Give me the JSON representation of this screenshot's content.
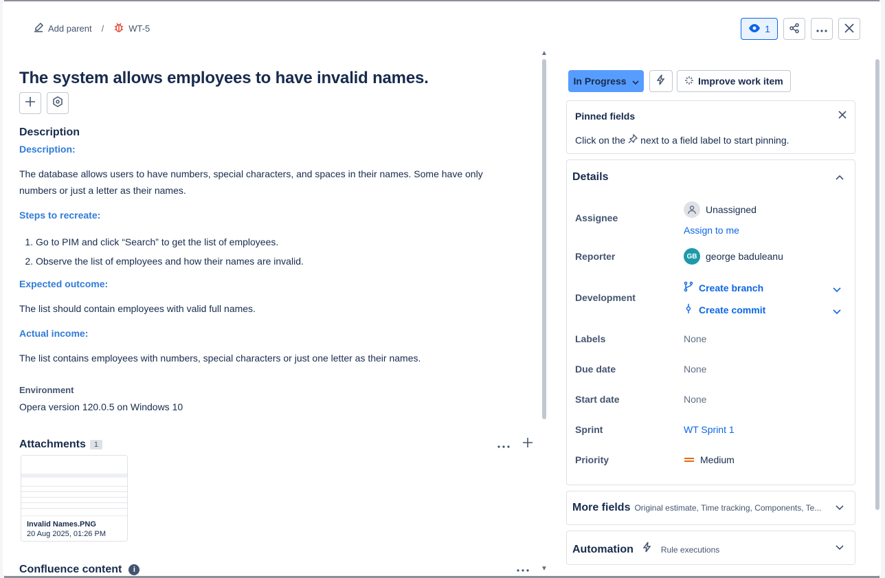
{
  "header": {
    "add_parent": "Add parent",
    "separator": "/",
    "issue_key": "WT-5",
    "watch_count": "1"
  },
  "issue": {
    "title": "The system allows employees to have invalid names.",
    "description_heading": "Description",
    "desc_label": "Description:",
    "desc_text": "The database allows users to have numbers, special characters, and spaces in their names. Some have only numbers or just a letter as their names.",
    "steps_label": "Steps to recreate:",
    "steps": [
      "Go to PIM and click “Search” to get the list of employees.",
      "Observe the list of employees and how their names are invalid."
    ],
    "expected_label": "Expected outcome:",
    "expected_text": "The list should contain employees with valid full names.",
    "actual_label": "Actual income:",
    "actual_text": "The list contains employees with numbers, special characters or just one letter as their names.",
    "environment_label": "Environment",
    "environment_value": "Opera version 120.0.5 on Windows 10"
  },
  "attachments": {
    "heading": "Attachments",
    "count": "1",
    "file_name": "Invalid Names.PNG",
    "file_date": "20 Aug 2025, 01:26 PM"
  },
  "confluence": {
    "heading": "Confluence content"
  },
  "sidebar": {
    "status": "In Progress",
    "improve": "Improve work item",
    "pinned_title": "Pinned fields",
    "pinned_text_before": "Click on the",
    "pinned_text_after": "next to a field label to start pinning.",
    "details_title": "Details",
    "assignee_label": "Assignee",
    "assignee_value": "Unassigned",
    "assign_to_me": "Assign to me",
    "reporter_label": "Reporter",
    "reporter_initials": "GB",
    "reporter_value": "george baduleanu",
    "development_label": "Development",
    "create_branch": "Create branch",
    "create_commit": "Create commit",
    "labels_label": "Labels",
    "labels_value": "None",
    "due_label": "Due date",
    "due_value": "None",
    "start_label": "Start date",
    "start_value": "None",
    "sprint_label": "Sprint",
    "sprint_value": "WT Sprint 1",
    "priority_label": "Priority",
    "priority_value": "Medium",
    "more_fields_title": "More fields",
    "more_fields_sub": "Original estimate, Time tracking, Components, Te...",
    "automation_title": "Automation",
    "automation_sub": "Rule executions"
  },
  "colors": {
    "accent": "#0c66e4",
    "status_bg": "#579dff",
    "heading_blue": "#2f7bd8",
    "bug_red": "#e2483d",
    "priority_orange": "#e56910"
  }
}
